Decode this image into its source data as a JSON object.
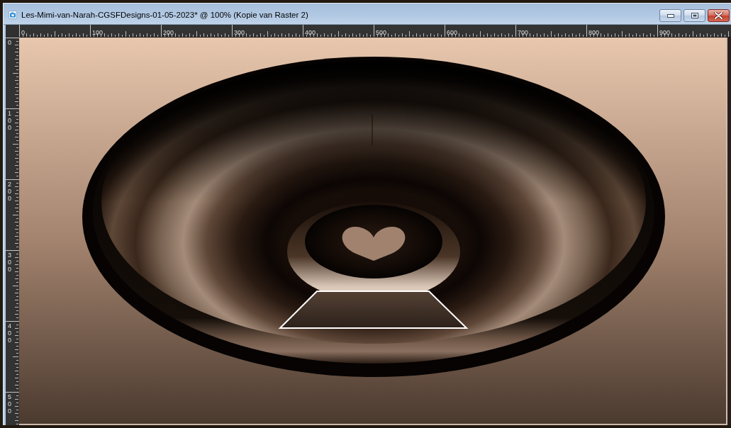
{
  "window": {
    "title": "Les-Mimi-van-Narah-CGSFDesigns-01-05-2023* @ 100% (Kopie van Raster 2)"
  },
  "rulers": {
    "horizontal": [
      "0",
      "100",
      "200",
      "300",
      "400",
      "500",
      "600",
      "700",
      "800",
      "900"
    ],
    "vertical": [
      "0",
      "100",
      "200",
      "300",
      "400",
      "500"
    ]
  }
}
